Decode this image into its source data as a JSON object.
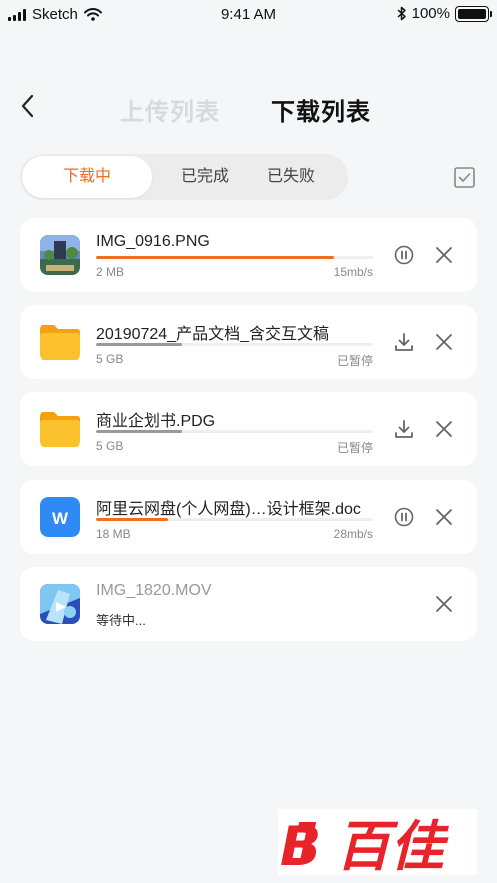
{
  "status_bar": {
    "carrier": "Sketch",
    "time": "9:41 AM",
    "battery": "100%"
  },
  "header": {
    "upload_tab": "上传列表",
    "download_tab": "下载列表"
  },
  "filter_tabs": [
    "下载中",
    "已完成",
    "已失败"
  ],
  "accent_color": "#f06e1d",
  "items": [
    {
      "name": "IMG_0916.PNG",
      "size": "2 MB",
      "status": "15mb/s",
      "progress": 0.86,
      "icon": "image-thumbnail",
      "action": "pause-icon"
    },
    {
      "name": "20190724_产品文档_含交互文稿",
      "size": "5 GB",
      "status": "已暂停",
      "progress": 0.31,
      "icon": "folder-icon",
      "action": "download-icon"
    },
    {
      "name": "商业企划书.PDG",
      "size": "5 GB",
      "status": "已暂停",
      "progress": 0.31,
      "icon": "folder-icon",
      "action": "download-icon"
    },
    {
      "name": "阿里云网盘(个人网盘)…设计框架.doc",
      "size": "18 MB",
      "status": "28mb/s",
      "progress": 0.26,
      "icon": "word-doc-icon",
      "action": "pause-icon"
    },
    {
      "name": "IMG_1820.MOV",
      "waiting": "等待中...",
      "icon": "video-thumbnail"
    }
  ],
  "watermark": "百佳"
}
